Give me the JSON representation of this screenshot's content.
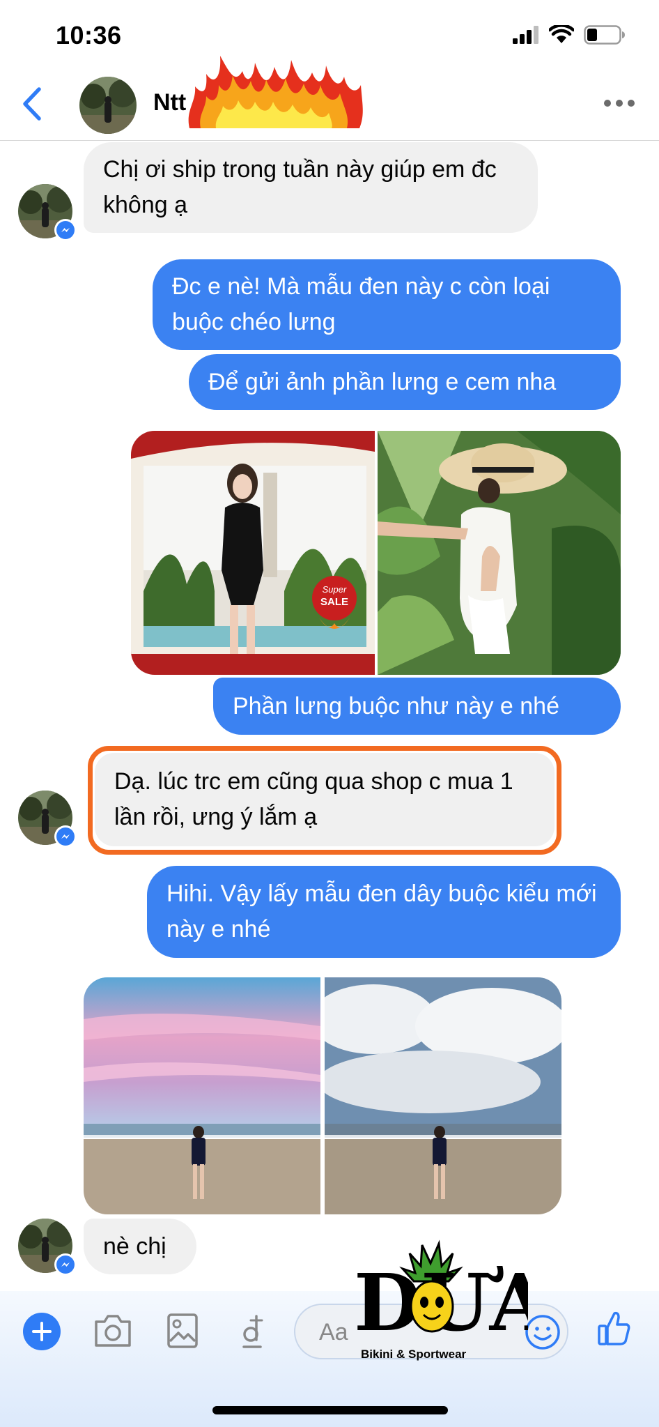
{
  "status_bar": {
    "time": "10:36"
  },
  "header": {
    "name": "Ntt",
    "more_label": "more options"
  },
  "messages": [
    {
      "text": "Chị ơi ship trong tuần này giúp em đc không ạ"
    },
    {
      "text": "Đc e nè! Mà mẫu đen này c còn loại buộc chéo lưng"
    },
    {
      "text": "Để gửi ảnh phần lưng e cem nha"
    },
    {
      "text": "Phần lưng buộc như này e nhé"
    },
    {
      "text": "Dạ. lúc trc em cũng qua shop c mua 1 lần rồi, ưng ý lắm ạ"
    },
    {
      "text": "Hihi. Vậy lấy mẫu đen dây buộc kiểu mới này e nhé"
    },
    {
      "text": "nè chị"
    }
  ],
  "photo_badge": {
    "top": "Super",
    "bottom": "SALE"
  },
  "composer": {
    "placeholder": "Aa"
  },
  "logo": {
    "brand": "DƯA",
    "tagline": "Bikini & Sportwear"
  },
  "colors": {
    "accent": "#3b82f2",
    "incoming": "#f0f0f0",
    "highlight": "#f26a21"
  }
}
